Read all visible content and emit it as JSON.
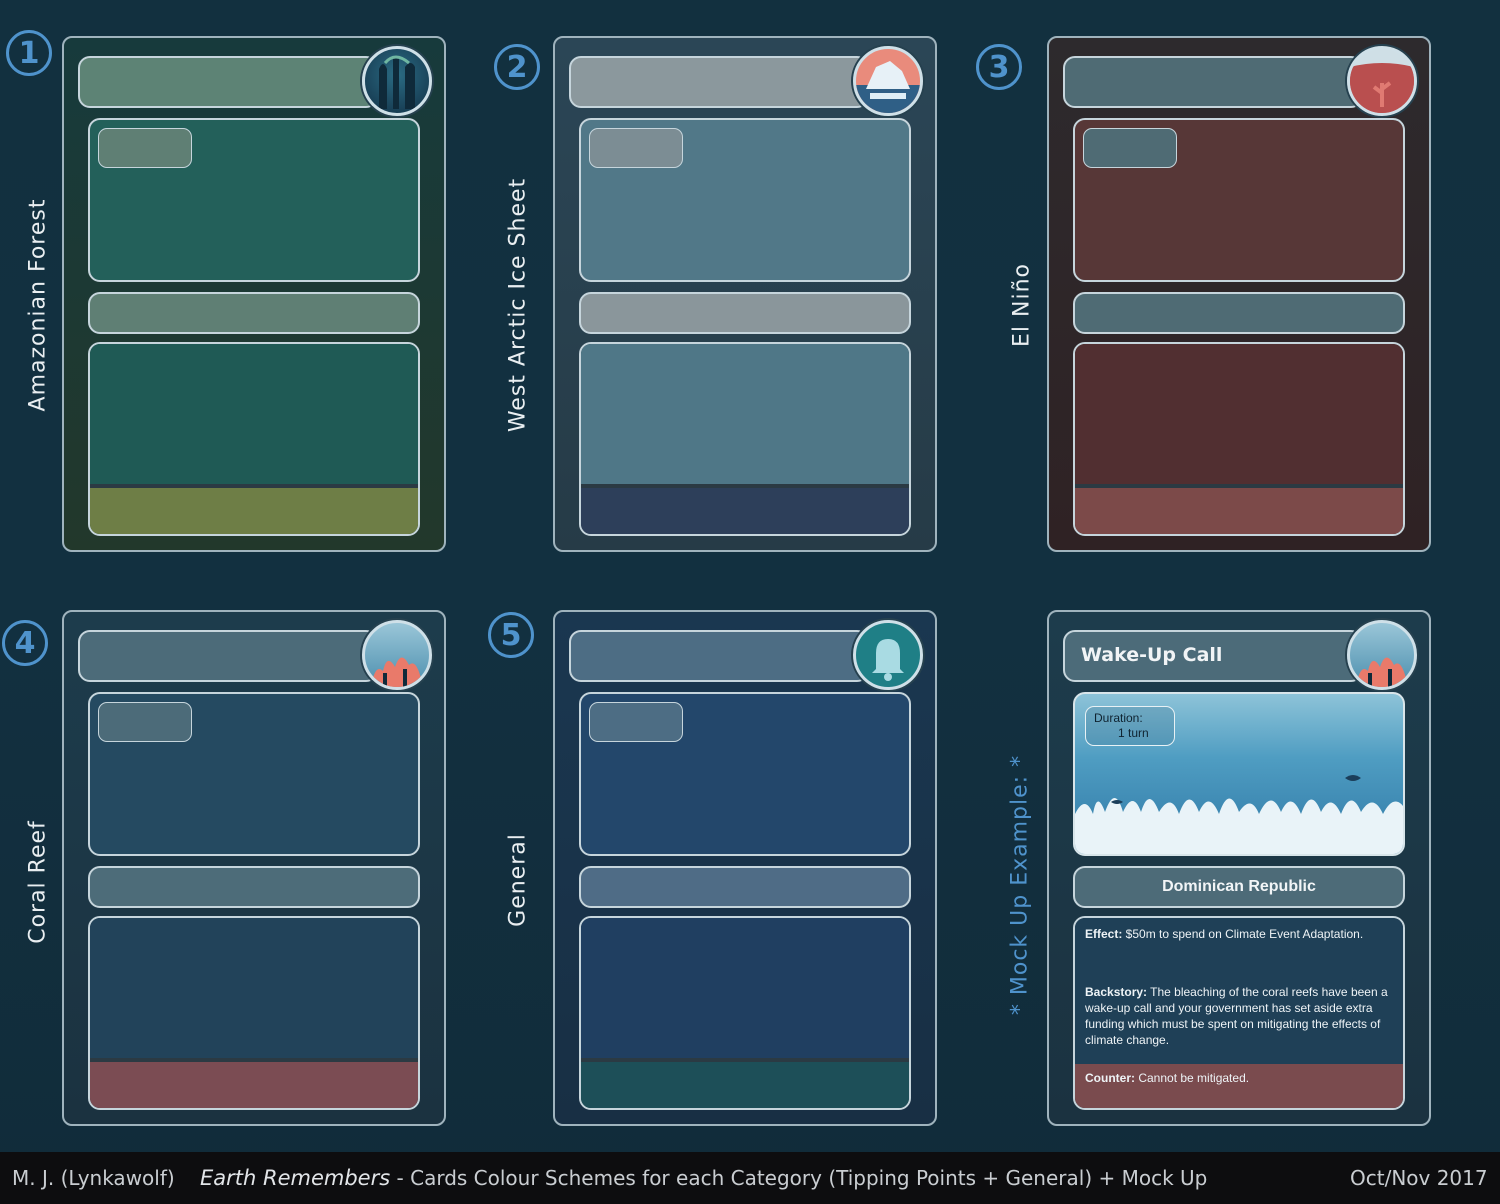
{
  "cards": [
    {
      "number": "1",
      "label": "Amazonian Forest",
      "colors": {
        "frame": "#1b3a37",
        "bar": "#5d8375",
        "panel": "#23605a",
        "strip": "#5f7f74",
        "footer": "#6e7e46"
      }
    },
    {
      "number": "2",
      "label": "West Arctic Ice Sheet",
      "colors": {
        "frame": "#2a4250",
        "bar": "#8b989d",
        "panel": "#517888",
        "strip": "#8a969b",
        "footer": "#2d3f5a"
      }
    },
    {
      "number": "3",
      "label": "El Niño",
      "colors": {
        "frame": "#2e2628",
        "bar": "#4f6b74",
        "panel": "#573737",
        "strip": "#4f6b74",
        "footer": "#7c4a49"
      }
    },
    {
      "number": "4",
      "label": "Coral Reef",
      "colors": {
        "frame": "#1b3443",
        "bar": "#4c6b79",
        "panel": "#254a61",
        "strip": "#4d6c79",
        "footer": "#7b4c53"
      }
    },
    {
      "number": "5",
      "label": "General",
      "colors": {
        "frame": "#19324a",
        "bar": "#4d6d84",
        "panel": "#23476b",
        "strip": "#4f6c86",
        "footer": "#1d4f58"
      }
    }
  ],
  "mockup": {
    "side_label": "* Mock Up Example: *",
    "title": "Wake-Up Call",
    "duration_label": "Duration:",
    "duration_value": "1 turn",
    "country": "Dominican Republic",
    "effect_label": "Effect:",
    "effect_text": " $50m to spend on Climate Event Adaptation.",
    "backstory_label": "Backstory:",
    "backstory_text": " The bleaching of the coral reefs have been a wake-up call and your government has set aside extra funding which must be spent on mitigating the effects of climate change.",
    "counter_label": "Counter:",
    "counter_text": " Cannot be mitigated."
  },
  "footer": {
    "author": "M. J. (Lynkawolf)",
    "game": "Earth Remembers",
    "subtitle": " - Cards Colour Schemes for each Category (Tipping Points + General) + Mock Up",
    "date": "Oct/Nov 2017"
  },
  "icons": [
    "forest-icon",
    "iceberg-icon",
    "el-nino-icon",
    "coral-icon",
    "bell-icon",
    "coral-icon"
  ]
}
